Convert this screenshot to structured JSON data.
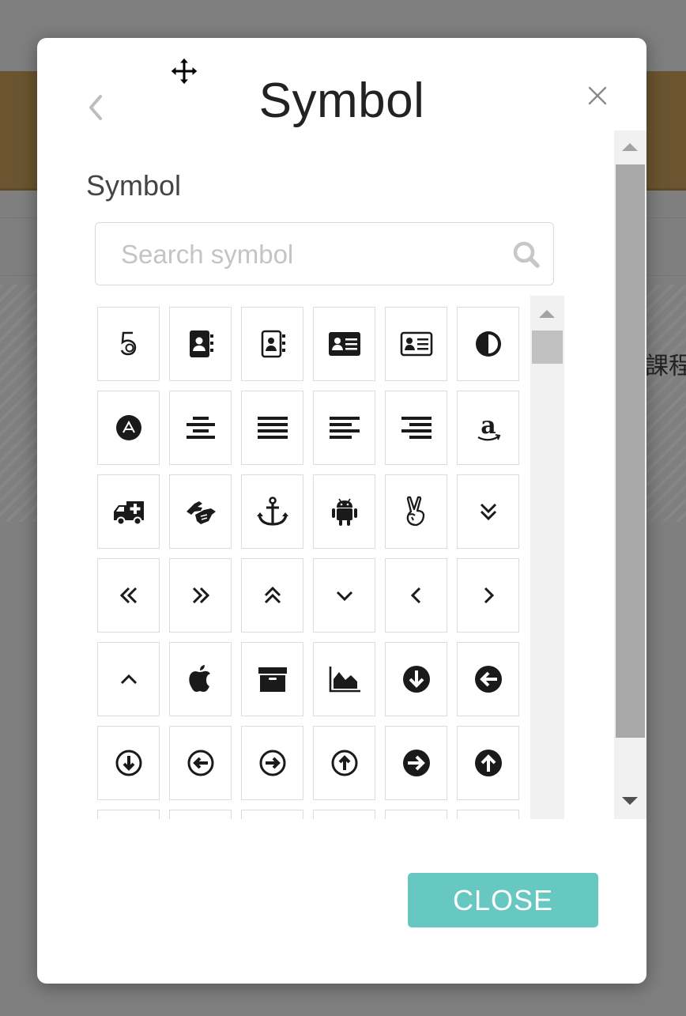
{
  "background": {
    "cjk_text": "課程"
  },
  "modal": {
    "title": "Symbol",
    "section_label": "Symbol",
    "search": {
      "placeholder": "Search symbol",
      "value": ""
    },
    "close_button": "CLOSE"
  },
  "colors": {
    "accent": "#66c8c0",
    "icon": "#1a1a1a"
  },
  "symbols": [
    "500px-icon",
    "address-book-icon",
    "address-book-o-icon",
    "address-card-icon",
    "address-card-o-icon",
    "adjust-icon",
    "adn-icon",
    "align-center-icon",
    "align-justify-icon",
    "align-left-icon",
    "align-right-icon",
    "amazon-icon",
    "ambulance-icon",
    "sign-language-icon",
    "anchor-icon",
    "android-icon",
    "angellist-icon",
    "angle-double-down-icon",
    "angle-double-left-icon",
    "angle-double-right-icon",
    "angle-double-up-icon",
    "angle-down-icon",
    "angle-left-icon",
    "angle-right-icon",
    "angle-up-icon",
    "apple-icon",
    "archive-icon",
    "area-chart-icon",
    "arrow-circle-down-icon",
    "arrow-circle-left-icon",
    "arrow-circle-o-down-icon",
    "arrow-circle-o-left-icon",
    "arrow-circle-o-right-icon",
    "arrow-circle-o-up-icon",
    "arrow-circle-right-icon",
    "arrow-circle-up-icon",
    "partial-icon-1",
    "partial-icon-2",
    "partial-icon-3",
    "partial-icon-4",
    "partial-icon-5",
    "partial-icon-6"
  ]
}
